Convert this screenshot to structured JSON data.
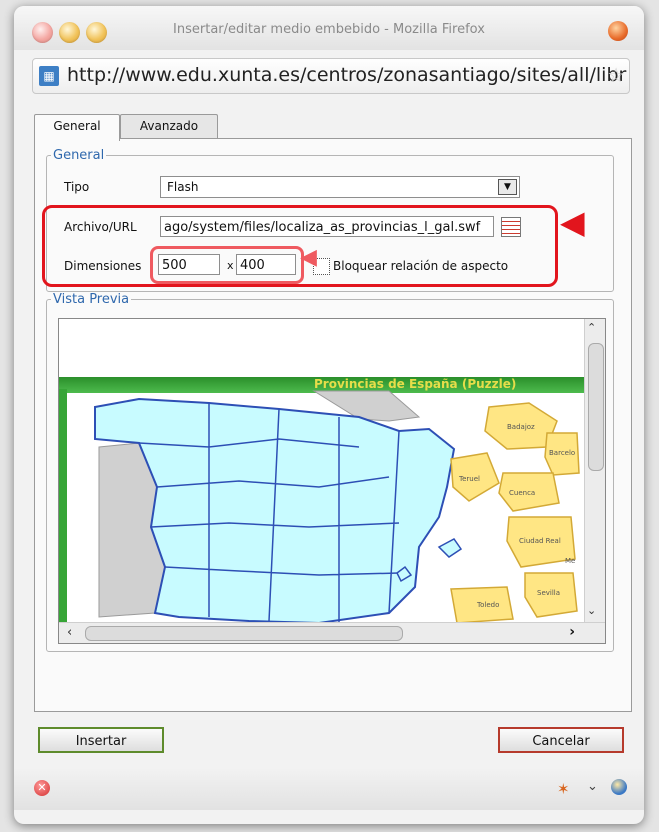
{
  "window": {
    "title": "Insertar/editar medio embebido - Mozilla Firefox",
    "url": "http://www.edu.xunta.es/centros/zonasantiago/sites/all/libr"
  },
  "tabs": [
    {
      "label": "General"
    },
    {
      "label": "Avanzado"
    }
  ],
  "general": {
    "legend": "General",
    "tipo_label": "Tipo",
    "tipo_value": "Flash",
    "archivo_label": "Archivo/URL",
    "archivo_value": "ago/system/files/localiza_as_provincias_l_gal.swf",
    "dim_label": "Dimensiones",
    "width": "500",
    "x_label": "x",
    "height": "400",
    "lock_label": "Bloquear relación de aspecto"
  },
  "preview": {
    "legend": "Vista Previa",
    "flash_title": "Provincias de España  (Puzzle)",
    "provinces": [
      "Badajoz",
      "Barcelo",
      "Teruel",
      "Cuenca",
      "Ciudad Real",
      "Me",
      "Sevilla",
      "Toledo"
    ]
  },
  "buttons": {
    "insert": "Insertar",
    "cancel": "Cancelar"
  },
  "colors": {
    "highlight": "#e2151d",
    "legend": "#2f68ad",
    "map_fill": "#c8fbff",
    "puzzle_fill": "#ffe684"
  }
}
